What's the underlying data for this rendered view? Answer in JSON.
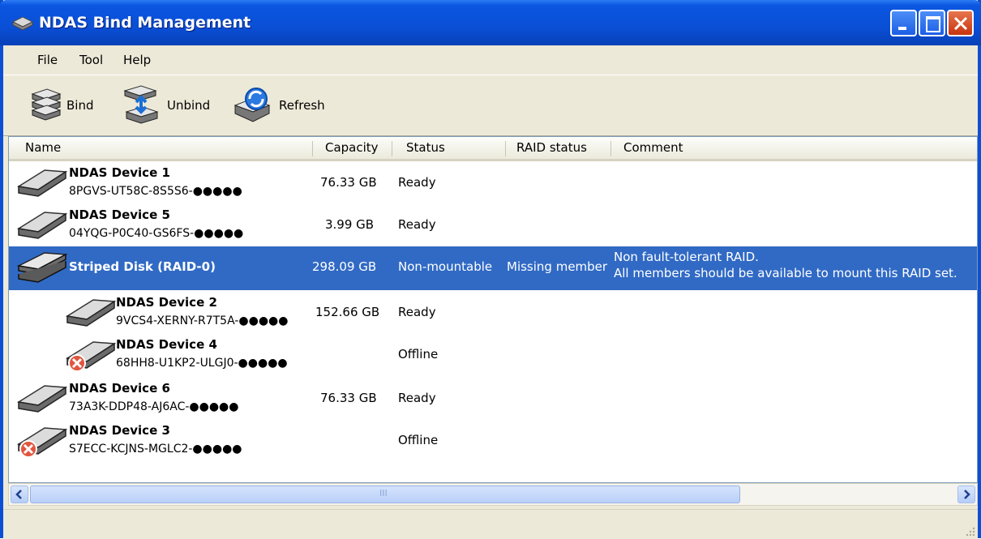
{
  "window": {
    "title": "NDAS Bind Management"
  },
  "menu": {
    "items": [
      "File",
      "Tool",
      "Help"
    ]
  },
  "toolbar": {
    "bind_label": "Bind",
    "unbind_label": "Unbind",
    "refresh_label": "Refresh"
  },
  "columns": [
    "Name",
    "Capacity",
    "Status",
    "RAID status",
    "Comment"
  ],
  "rows": [
    {
      "name": "NDAS Device 1",
      "id": "8PGVS-UT58C-8S5S6-●●●●●",
      "capacity": "76.33 GB",
      "status": "Ready",
      "raid_status": "",
      "comment1": "",
      "comment2": "",
      "icon": "disk-icon"
    },
    {
      "name": "NDAS Device 5",
      "id": "04YQG-P0C40-GS6FS-●●●●●",
      "capacity": "3.99 GB",
      "status": "Ready",
      "raid_status": "",
      "comment1": "",
      "comment2": "",
      "icon": "disk-icon"
    },
    {
      "name": "Striped Disk (RAID-0)",
      "id": "",
      "capacity": "298.09 GB",
      "status": "Non-mountable",
      "raid_status": "Missing member",
      "comment1": "Non fault-tolerant RAID.",
      "comment2": "All members should be available to mount this RAID set.",
      "icon": "raid-disk-icon",
      "selected": true
    },
    {
      "name": "NDAS Device 2",
      "id": "9VCS4-XERNY-R7T5A-●●●●●",
      "capacity": "152.66 GB",
      "status": "Ready",
      "raid_status": "",
      "comment1": "",
      "comment2": "",
      "icon": "disk-icon",
      "child": true
    },
    {
      "name": "NDAS Device 4",
      "id": "68HH8-U1KP2-ULGJ0-●●●●●",
      "capacity": "",
      "status": "Offline",
      "raid_status": "",
      "comment1": "",
      "comment2": "",
      "icon": "offline-disk-icon",
      "child": true
    },
    {
      "name": "NDAS Device 6",
      "id": "73A3K-DDP48-AJ6AC-●●●●●",
      "capacity": "76.33 GB",
      "status": "Ready",
      "raid_status": "",
      "comment1": "",
      "comment2": "",
      "icon": "disk-icon"
    },
    {
      "name": "NDAS Device 3",
      "id": "S7ECC-KCJNS-MGLC2-●●●●●",
      "capacity": "",
      "status": "Offline",
      "raid_status": "",
      "comment1": "",
      "comment2": "",
      "icon": "offline-disk-icon"
    }
  ],
  "scrollbar": {
    "thumb_grip": "III"
  },
  "colors": {
    "title_blue": "#0a4fd6",
    "selection": "#316ac5",
    "close_red": "#c7340e"
  }
}
